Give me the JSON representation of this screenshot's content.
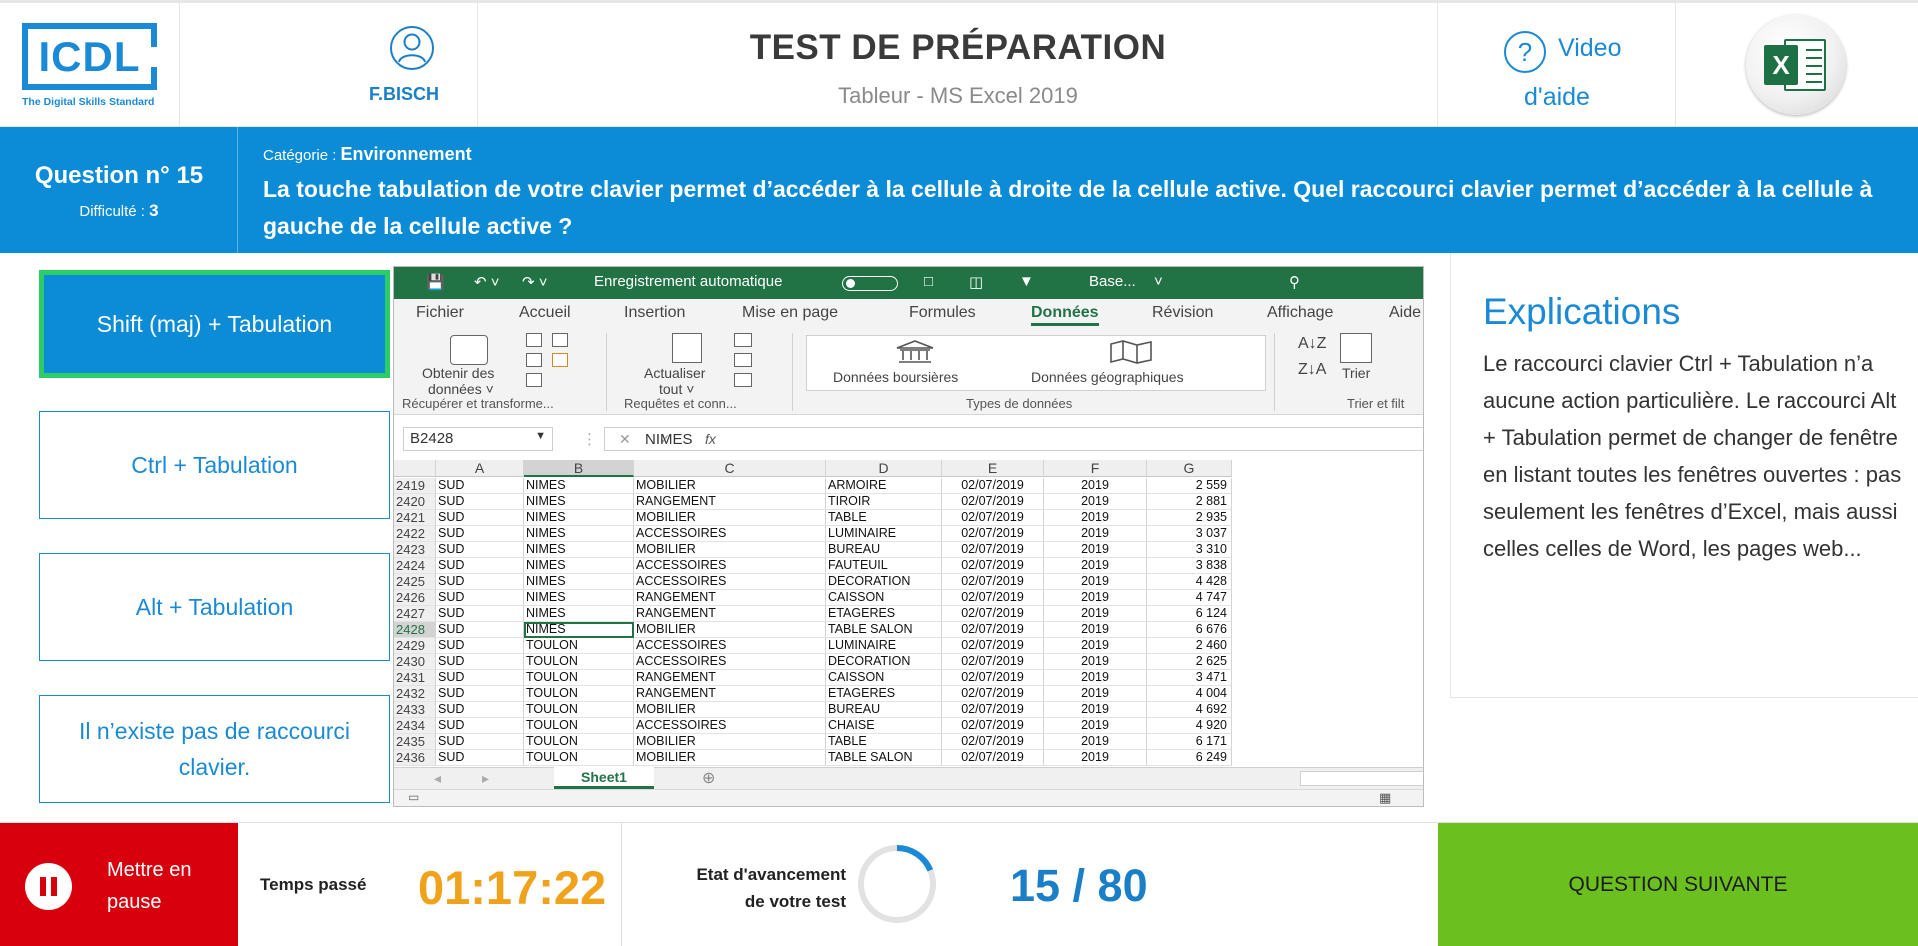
{
  "header": {
    "logo": "ICDL",
    "logo_tagline": "The Digital Skills Standard",
    "user_name": "F.BISCH",
    "title": "TEST DE PRÉPARATION",
    "subtitle": "Tableur - MS Excel 2019",
    "help_line1": "Video",
    "help_line2": "d'aide",
    "excel_icon_letter": "X"
  },
  "question": {
    "number_label": "Question n° 15",
    "difficulty_label": "Difficulté : ",
    "difficulty_value": "3",
    "category_label": "Catégorie : ",
    "category_value": "Environnement",
    "text": "La touche tabulation de votre clavier permet d’accéder à la cellule à droite de la cellule active. Quel raccourci clavier permet d’accéder à la cellule à gauche de la cellule active ?"
  },
  "answers": [
    {
      "label": "Shift (maj) + Tabulation",
      "selected": true
    },
    {
      "label": "Ctrl + Tabulation",
      "selected": false
    },
    {
      "label": "Alt + Tabulation",
      "selected": false
    },
    {
      "label": "Il n’existe pas de raccourci clavier.",
      "selected": false
    }
  ],
  "excel": {
    "autosave_label": "Enregistrement automatique",
    "filename": "Base...",
    "tabs": [
      "Fichier",
      "Accueil",
      "Insertion",
      "Mise en page",
      "Formules",
      "Données",
      "Révision",
      "Affichage",
      "Aide"
    ],
    "active_tab": "Données",
    "ribbon": {
      "get_data": "Obtenir des",
      "get_data2": "données ˅",
      "refresh": "Actualiser",
      "refresh2": "tout ˅",
      "stocks": "Données boursières",
      "geo": "Données géographiques",
      "sort": "Trier",
      "group_get": "Récupérer et transforme...",
      "group_queries": "Requêtes et conn...",
      "group_types": "Types de données",
      "group_sort": "Trier et filt"
    },
    "name_box": "B2428",
    "formula_value": "NIMES",
    "fx_symbol": "fx",
    "columns": [
      "A",
      "B",
      "C",
      "D",
      "E",
      "F",
      "G"
    ],
    "selected_column": "B",
    "rows": [
      [
        "2419",
        "SUD",
        "NIMES",
        "MOBILIER",
        "ARMOIRE",
        "02/07/2019",
        "2019",
        "2 559"
      ],
      [
        "2420",
        "SUD",
        "NIMES",
        "RANGEMENT",
        "TIROIR",
        "02/07/2019",
        "2019",
        "2 881"
      ],
      [
        "2421",
        "SUD",
        "NIMES",
        "MOBILIER",
        "TABLE",
        "02/07/2019",
        "2019",
        "2 935"
      ],
      [
        "2422",
        "SUD",
        "NIMES",
        "ACCESSOIRES",
        "LUMINAIRE",
        "02/07/2019",
        "2019",
        "3 037"
      ],
      [
        "2423",
        "SUD",
        "NIMES",
        "MOBILIER",
        "BUREAU",
        "02/07/2019",
        "2019",
        "3 310"
      ],
      [
        "2424",
        "SUD",
        "NIMES",
        "ACCESSOIRES",
        "FAUTEUIL",
        "02/07/2019",
        "2019",
        "3 838"
      ],
      [
        "2425",
        "SUD",
        "NIMES",
        "ACCESSOIRES",
        "DECORATION",
        "02/07/2019",
        "2019",
        "4 428"
      ],
      [
        "2426",
        "SUD",
        "NIMES",
        "RANGEMENT",
        "CAISSON",
        "02/07/2019",
        "2019",
        "4 747"
      ],
      [
        "2427",
        "SUD",
        "NIMES",
        "RANGEMENT",
        "ETAGERES",
        "02/07/2019",
        "2019",
        "6 124"
      ],
      [
        "2428",
        "SUD",
        "NIMES",
        "MOBILIER",
        "TABLE SALON",
        "02/07/2019",
        "2019",
        "6 676"
      ],
      [
        "2429",
        "SUD",
        "TOULON",
        "ACCESSOIRES",
        "LUMINAIRE",
        "02/07/2019",
        "2019",
        "2 460"
      ],
      [
        "2430",
        "SUD",
        "TOULON",
        "ACCESSOIRES",
        "DECORATION",
        "02/07/2019",
        "2019",
        "2 625"
      ],
      [
        "2431",
        "SUD",
        "TOULON",
        "RANGEMENT",
        "CAISSON",
        "02/07/2019",
        "2019",
        "3 471"
      ],
      [
        "2432",
        "SUD",
        "TOULON",
        "RANGEMENT",
        "ETAGERES",
        "02/07/2019",
        "2019",
        "4 004"
      ],
      [
        "2433",
        "SUD",
        "TOULON",
        "MOBILIER",
        "BUREAU",
        "02/07/2019",
        "2019",
        "4 692"
      ],
      [
        "2434",
        "SUD",
        "TOULON",
        "ACCESSOIRES",
        "CHAISE",
        "02/07/2019",
        "2019",
        "4 920"
      ],
      [
        "2435",
        "SUD",
        "TOULON",
        "MOBILIER",
        "TABLE",
        "02/07/2019",
        "2019",
        "6 171"
      ],
      [
        "2436",
        "SUD",
        "TOULON",
        "MOBILIER",
        "TABLE SALON",
        "02/07/2019",
        "2019",
        "6 249"
      ]
    ],
    "active_row": "2428",
    "sheet_name": "Sheet1"
  },
  "explanations": {
    "title": "Explications",
    "body": "Le raccourci clavier Ctrl + Tabulation n’a aucune action particulière. Le raccourci Alt + Tabulation permet de changer de fenêtre en listant toutes les fenêtres ouvertes : pas seulement les fenêtres d’Excel, mais aussi celles celles de Word, les pages web..."
  },
  "footer": {
    "pause_line1": "Mettre en",
    "pause_line2": "pause",
    "time_label": "Temps passé",
    "time_value": "01:17:22",
    "progress_line1": "Etat d'avancement",
    "progress_line2": "de votre test",
    "progress_text": "15 / 80",
    "progress_fraction": 0.1875,
    "next_label": "QUESTION SUIVANTE"
  },
  "colors": {
    "primary_blue": "#0c8bd6",
    "selected_border": "#2ccc66",
    "pause_red": "#d9000d",
    "timer_orange": "#f0a21a",
    "next_green": "#6bbf1e",
    "excel_green": "#217346"
  }
}
